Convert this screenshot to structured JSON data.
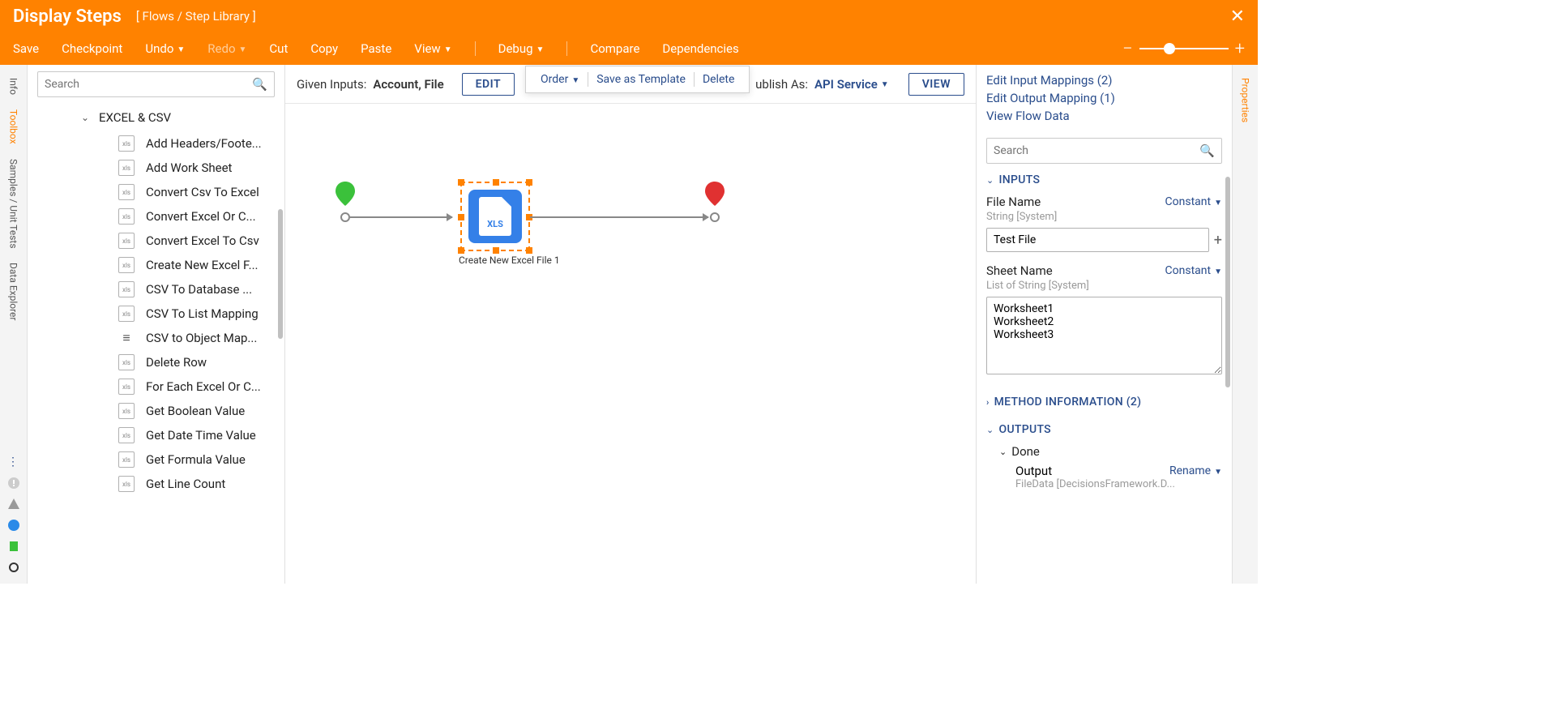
{
  "header": {
    "title": "Display Steps",
    "breadcrumb": "[ Flows / Step Library ]",
    "menu": {
      "save": "Save",
      "checkpoint": "Checkpoint",
      "undo": "Undo",
      "redo": "Redo",
      "cut": "Cut",
      "copy": "Copy",
      "paste": "Paste",
      "view": "View",
      "debug": "Debug",
      "compare": "Compare",
      "dependencies": "Dependencies"
    }
  },
  "left_tabs": {
    "info": "Info",
    "toolbox": "Toolbox",
    "samples": "Samples / Unit Tests",
    "data_explorer": "Data Explorer"
  },
  "toolbox": {
    "search_placeholder": "Search",
    "category": "EXCEL & CSV",
    "items": [
      "Add Headers/Foote...",
      "Add Work Sheet",
      "Convert Csv To Excel",
      "Convert Excel Or C...",
      "Convert Excel To Csv",
      "Create New Excel F...",
      "CSV To Database ...",
      "CSV To List Mapping",
      "CSV to Object Map...",
      "Delete Row",
      "For Each Excel Or C...",
      "Get Boolean Value",
      "Get Date Time Value",
      "Get Formula Value",
      "Get Line Count"
    ]
  },
  "canvas_toolbar": {
    "given_inputs_label": "Given Inputs:",
    "given_inputs_value": "Account, File",
    "edit": "EDIT",
    "publish_as": "ublish As:",
    "publish_value": "API Service",
    "view": "VIEW"
  },
  "context_menu": {
    "order": "Order",
    "save_template": "Save as Template",
    "delete": "Delete"
  },
  "canvas": {
    "step_title": "Create New Excel File 1",
    "step_badge": "XLS"
  },
  "right_panel": {
    "search_placeholder": "Search",
    "links": {
      "edit_input": "Edit Input Mappings (2)",
      "edit_output": "Edit Output Mapping (1)",
      "view_flow": "View Flow Data"
    },
    "sections": {
      "inputs": "INPUTS",
      "method_info": "METHOD INFORMATION (2)",
      "outputs": "OUTPUTS"
    },
    "inputs": {
      "file_name": {
        "label": "File Name",
        "mapping": "Constant",
        "type": "String [System]",
        "value": "Test File"
      },
      "sheet_name": {
        "label": "Sheet Name",
        "mapping": "Constant",
        "type": "List of String [System]",
        "value": "Worksheet1\nWorksheet2\nWorksheet3"
      }
    },
    "outputs": {
      "done": "Done",
      "output_label": "Output",
      "rename": "Rename",
      "output_type": "FileData [DecisionsFramework.D..."
    }
  },
  "right_tab": "Properties"
}
